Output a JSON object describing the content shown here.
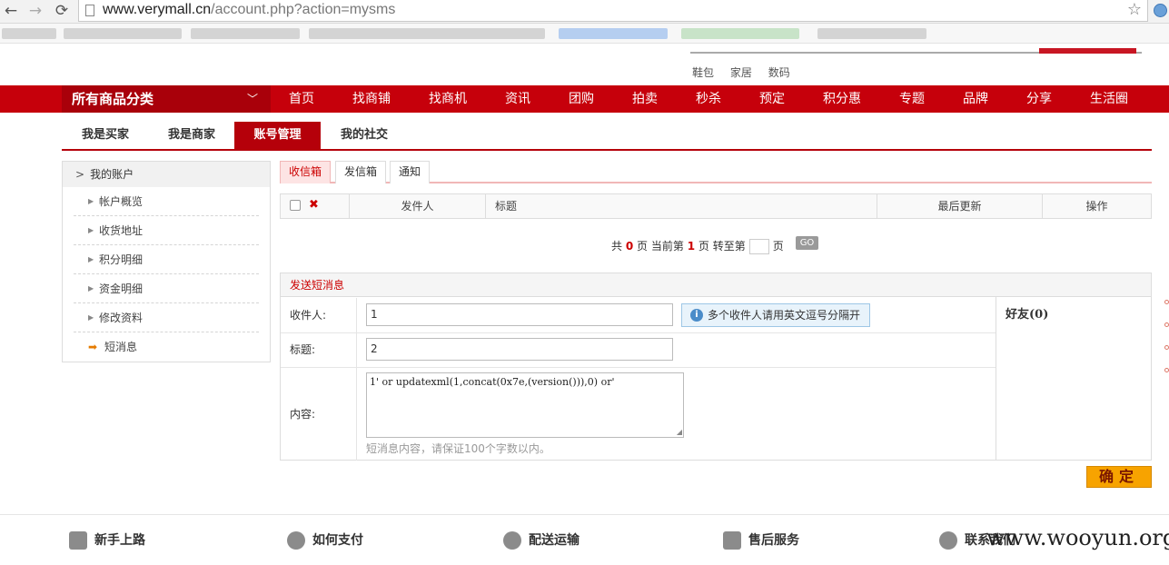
{
  "browser": {
    "back": "←",
    "forward": "→",
    "reload": "⟳",
    "url_host": "www.verymall.cn",
    "url_path": "/account.php?action=mysms",
    "bookmark_star": "☆"
  },
  "top_links": [
    "鞋包",
    "家居",
    "数码"
  ],
  "nav": {
    "all_categories": "所有商品分类",
    "items": [
      "首页",
      "找商铺",
      "找商机",
      "资讯",
      "团购",
      "拍卖",
      "秒杀",
      "预定",
      "积分惠",
      "专题",
      "品牌",
      "分享",
      "生活圈"
    ]
  },
  "sub_tabs": [
    "我是买家",
    "我是商家",
    "账号管理",
    "我的社交"
  ],
  "sidebar": {
    "header": "我的账户",
    "items": [
      "帐户概览",
      "收货地址",
      "积分明细",
      "资金明细",
      "修改资料",
      "短消息"
    ]
  },
  "msg_tabs": [
    "收信箱",
    "发信箱",
    "通知"
  ],
  "inbox": {
    "columns": [
      "发件人",
      "标题",
      "最后更新",
      "操作"
    ]
  },
  "pager": {
    "total_prefix": "共",
    "total": "0",
    "current_label": "页 当前第",
    "current": "1",
    "goto_label": "页 转至第",
    "page_suffix": "页",
    "go": "GO"
  },
  "send": {
    "title": "发送短消息",
    "recipient_label": "收件人:",
    "recipient_value": "1",
    "hint": "多个收件人请用英文逗号分隔开",
    "subject_label": "标题:",
    "subject_value": "2",
    "content_label": "内容:",
    "content_value": "1' or updatexml(1,concat(0x7e,(version())),0) or'",
    "content_tip": "短消息内容，请保证100个字数以内。",
    "friends": "好友(0)",
    "confirm": "确定"
  },
  "footer": [
    "新手上路",
    "如何支付",
    "配送运输",
    "售后服务",
    "联系我们"
  ],
  "watermark": "www.wooyun.org",
  "colors": {
    "brand_red": "#c6000b",
    "confirm_orange": "#f7a300"
  }
}
